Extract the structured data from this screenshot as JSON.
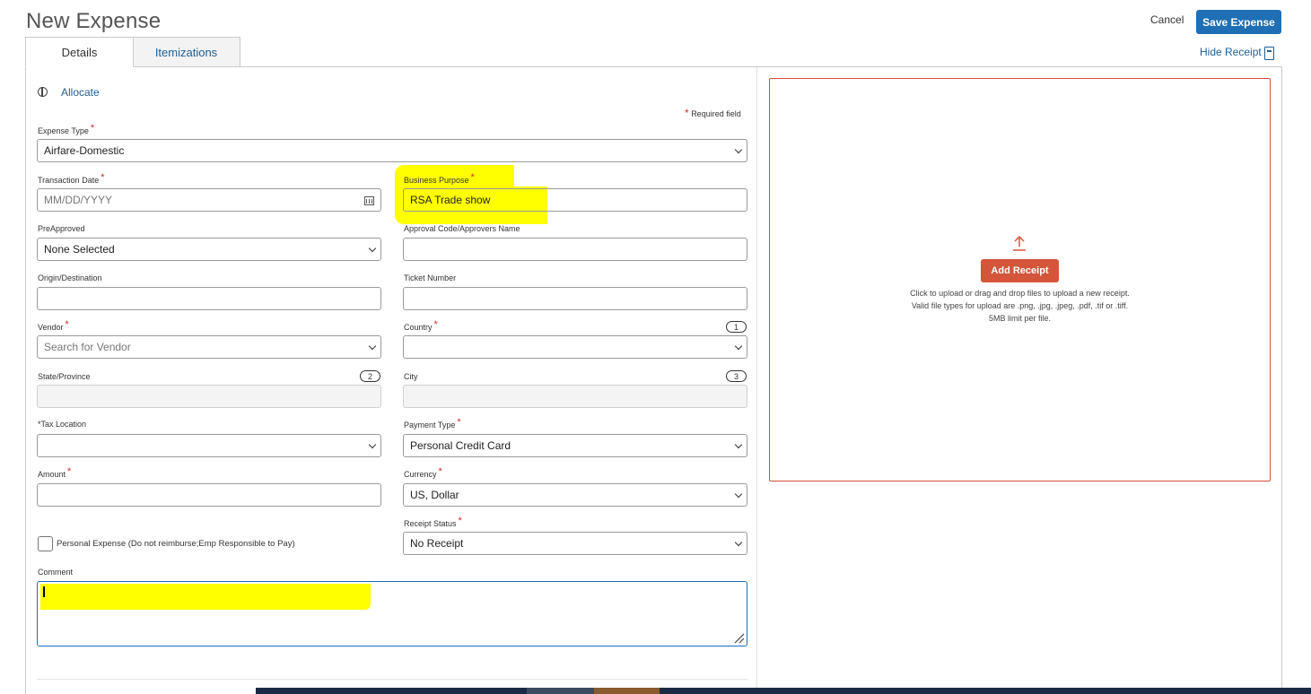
{
  "header": {
    "title": "New Expense",
    "cancel_label": "Cancel",
    "save_label": "Save Expense",
    "hide_receipt_label": "Hide Receipt"
  },
  "tabs": [
    {
      "label": "Details",
      "active": true
    },
    {
      "label": "Itemizations",
      "active": false
    }
  ],
  "allocate_label": "Allocate",
  "required_note": "Required field",
  "fields": {
    "expense_type": {
      "label": "Expense Type",
      "value": "Airfare-Domestic"
    },
    "transaction_date": {
      "label": "Transaction Date",
      "placeholder": "MM/DD/YYYY"
    },
    "business_purpose": {
      "label": "Business Purpose",
      "value": "RSA Trade show"
    },
    "preapproved": {
      "label": "PreApproved",
      "value": "None Selected"
    },
    "approval_code": {
      "label": "Approval Code/Approvers Name",
      "value": ""
    },
    "origin_destination": {
      "label": "Origin/Destination",
      "value": ""
    },
    "ticket_number": {
      "label": "Ticket Number",
      "value": ""
    },
    "vendor": {
      "label": "Vendor",
      "placeholder": "Search for Vendor"
    },
    "country": {
      "label": "Country",
      "value": "",
      "badge": "1"
    },
    "state_province": {
      "label": "State/Province",
      "value": "",
      "badge": "2"
    },
    "city": {
      "label": "City",
      "value": "",
      "badge": "3"
    },
    "tax_location": {
      "label": "*Tax Location",
      "value": ""
    },
    "payment_type": {
      "label": "Payment Type",
      "value": "Personal Credit Card"
    },
    "amount": {
      "label": "Amount",
      "value": ""
    },
    "currency": {
      "label": "Currency",
      "value": "US, Dollar"
    },
    "receipt_status": {
      "label": "Receipt Status",
      "value": "No Receipt"
    },
    "personal_expense": {
      "label": "Personal Expense (Do not reimburse;Emp Responsible to Pay)",
      "checked": false
    },
    "comment": {
      "label": "Comment",
      "value": ""
    }
  },
  "receipt": {
    "button_label": "Add Receipt",
    "line1": "Click to upload or drag and drop files to upload a new receipt.",
    "line2": "Valid file types for upload are .png, .jpg, .jpeg, .pdf, .tif or .tiff.",
    "line3": "5MB limit per file."
  },
  "colors": {
    "primary": "#1f6fb5",
    "link": "#1e5e96",
    "required": "#c9302c",
    "receipt_accent": "#d4553a",
    "highlight": "#ffff00"
  }
}
